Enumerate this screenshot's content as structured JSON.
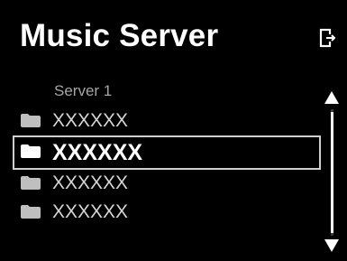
{
  "screen": {
    "title": "Music Server",
    "input_icon": "input-switch-icon"
  },
  "server_label": "Server 1",
  "items": [
    {
      "label": "XXXXXX",
      "icon": "folder-icon",
      "selected": false
    },
    {
      "label": "XXXXXX",
      "icon": "folder-icon",
      "selected": true
    },
    {
      "label": "XXXXXX",
      "icon": "folder-icon",
      "selected": false
    },
    {
      "label": "XXXXXX",
      "icon": "folder-icon",
      "selected": false
    }
  ],
  "scrollbar": {
    "up_icon": "triangle-up-icon",
    "down_icon": "triangle-down-icon"
  },
  "colors": {
    "background": "#000000",
    "text": "#ffffff",
    "dim_text": "#a6a6a6",
    "highlight_border": "#cfcfcf"
  }
}
